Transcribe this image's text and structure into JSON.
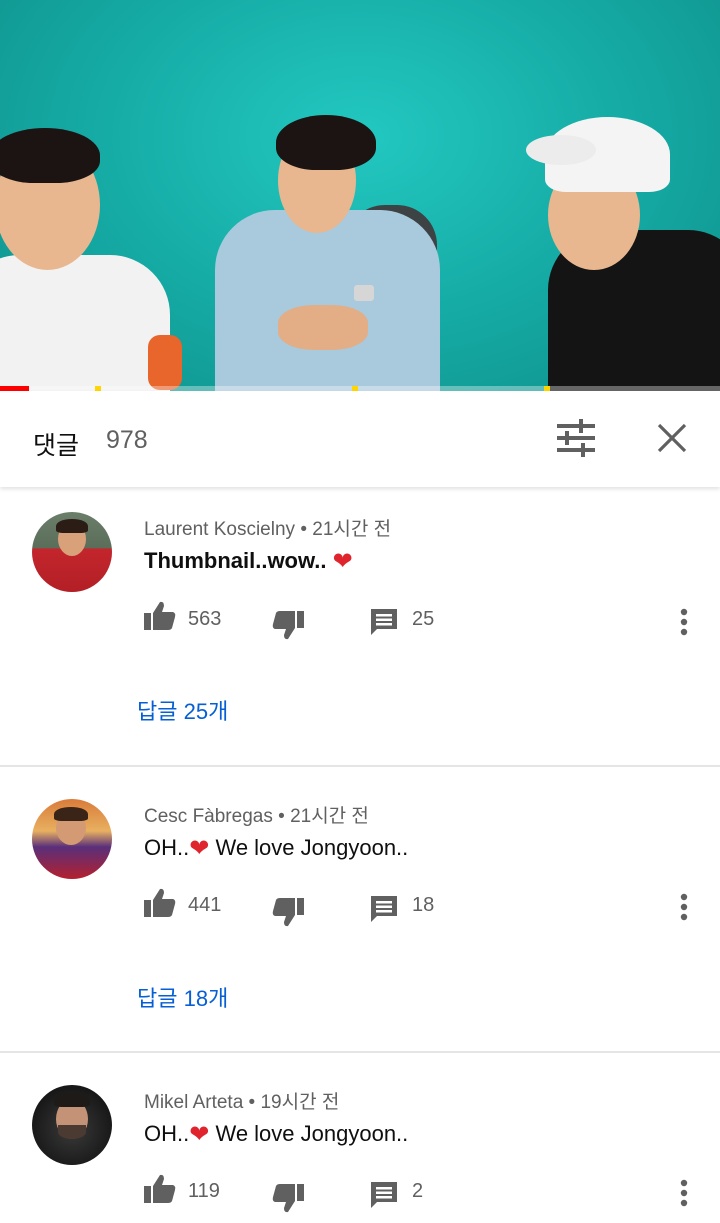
{
  "video": {
    "progress_fraction": 0.04,
    "accent_progress": "#ff0000",
    "ad_marker_color": "#ffd600"
  },
  "comments_panel": {
    "title": "댓글",
    "count": "978",
    "sort_icon": "sliders-icon",
    "close_icon": "close-icon"
  },
  "comments": [
    {
      "author": "Laurent Koscielny",
      "time": "21시간 전",
      "text": "Thumbnail..wow.. ",
      "heart": "❤",
      "bold": true,
      "likes": "563",
      "replies_count": "25",
      "replies_label": "답글 25개"
    },
    {
      "author": "Cesc Fàbregas",
      "time": "21시간 전",
      "text_before": "OH..",
      "heart": "❤",
      "text_after": " We love Jongyoon..",
      "likes": "441",
      "replies_count": "18",
      "replies_label": "답글 18개"
    },
    {
      "author": "Mikel Arteta",
      "time": "19시간 전",
      "text_before": "OH..",
      "heart": "❤",
      "text_after": " We love Jongyoon..",
      "likes": "119",
      "replies_count": "2"
    }
  ],
  "colors": {
    "link_blue": "#065fd4",
    "meta_gray": "#606060",
    "heart_red": "#e0242e"
  }
}
